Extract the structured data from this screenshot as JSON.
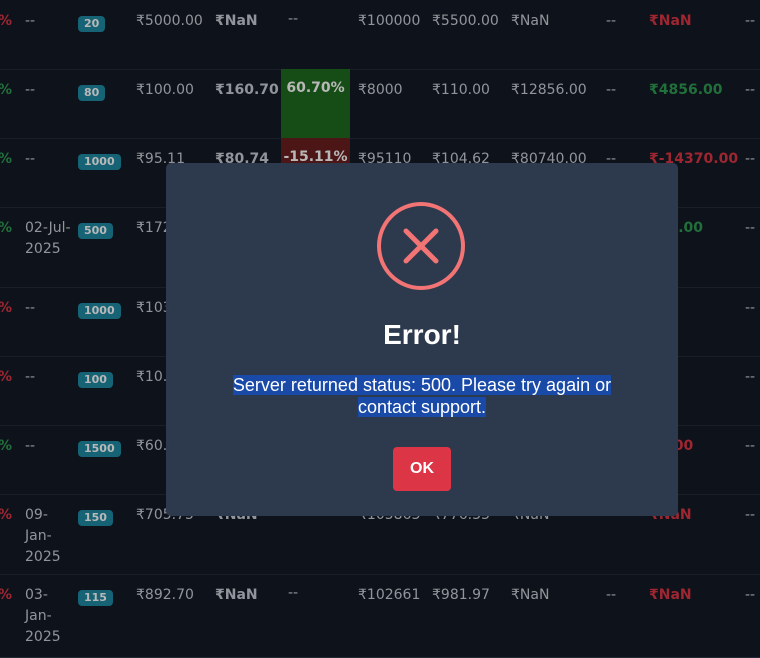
{
  "rows": [
    {
      "pct": "%",
      "pct_type": "neg",
      "date": "--",
      "qty": "20",
      "buy": "₹5000.00",
      "ltp": "₹NaN",
      "chg": "--",
      "chg_type": "none",
      "invested": "₹100000",
      "target": "₹5500.00",
      "current": "₹NaN",
      "dash": "--",
      "pl": "₹NaN",
      "pl_type": "neg",
      "last": "--"
    },
    {
      "pct": "%",
      "pct_type": "pos",
      "date": "--",
      "qty": "80",
      "buy": "₹100.00",
      "ltp": "₹160.70",
      "chg": "60.70%",
      "chg_type": "up",
      "invested": "₹8000",
      "target": "₹110.00",
      "current": "₹12856.00",
      "dash": "--",
      "pl": "₹4856.00",
      "pl_type": "pos",
      "last": "--"
    },
    {
      "pct": "%",
      "pct_type": "pos",
      "date": "--",
      "qty": "1000",
      "buy": "₹95.11",
      "ltp": "₹80.74",
      "chg": "-15.11%",
      "chg_type": "down",
      "invested": "₹95110",
      "target": "₹104.62",
      "current": "₹80740.00",
      "dash": "--",
      "pl": "₹-14370.00",
      "pl_type": "neg",
      "last": "--"
    },
    {
      "pct": "%",
      "pct_type": "pos",
      "date": "02-Jul-2025",
      "qty": "500",
      "buy": "₹172",
      "ltp": "",
      "chg": "",
      "chg_type": "none",
      "invested": "",
      "target": "",
      "current": "",
      "dash": "",
      "pl": "850.00",
      "pl_type": "pos",
      "last": "--"
    },
    {
      "pct": "%",
      "pct_type": "neg",
      "date": "--",
      "qty": "1000",
      "buy": "₹103",
      "ltp": "",
      "chg": "",
      "chg_type": "none",
      "invested": "",
      "target": "",
      "current": "",
      "dash": "",
      "pl": "N",
      "pl_type": "neg",
      "last": "--"
    },
    {
      "pct": "%",
      "pct_type": "neg",
      "date": "--",
      "qty": "100",
      "buy": "₹10.5",
      "ltp": "",
      "chg": "",
      "chg_type": "none",
      "invested": "",
      "target": "",
      "current": "",
      "dash": "",
      "pl": "N",
      "pl_type": "neg",
      "last": "--"
    },
    {
      "pct": "%",
      "pct_type": "pos",
      "date": "--",
      "qty": "1500",
      "buy": "₹60.",
      "ltp": "",
      "chg": "",
      "chg_type": "none",
      "invested": "",
      "target": "",
      "current": "",
      "dash": "",
      "pl": "30.00",
      "pl_type": "neg",
      "last": "--"
    },
    {
      "pct": "%",
      "pct_type": "neg",
      "date": "09-Jan-2025",
      "qty": "150",
      "buy": "₹705.75",
      "ltp": "₹NaN",
      "chg": "",
      "chg_type": "none",
      "invested": "₹105863",
      "target": "₹776.33",
      "current": "₹NaN",
      "dash": "",
      "pl": "₹NaN",
      "pl_type": "neg",
      "last": "--"
    },
    {
      "pct": "%",
      "pct_type": "neg",
      "date": "03-Jan-2025",
      "qty": "115",
      "buy": "₹892.70",
      "ltp": "₹NaN",
      "chg": "--",
      "chg_type": "none",
      "invested": "₹102661",
      "target": "₹981.97",
      "current": "₹NaN",
      "dash": "--",
      "pl": "₹NaN",
      "pl_type": "neg",
      "last": "--"
    }
  ],
  "modal": {
    "title": "Error!",
    "message": "Server returned status: 500. Please try again or contact support.",
    "ok_label": "OK",
    "icon": "error-x-icon",
    "icon_color": "#f27474"
  },
  "colors": {
    "positive": "#2e9b53",
    "negative": "#dc3545",
    "badge": "#1f8aa3",
    "modal_bg": "#2d3a4d",
    "ok_button": "#dc3545"
  }
}
